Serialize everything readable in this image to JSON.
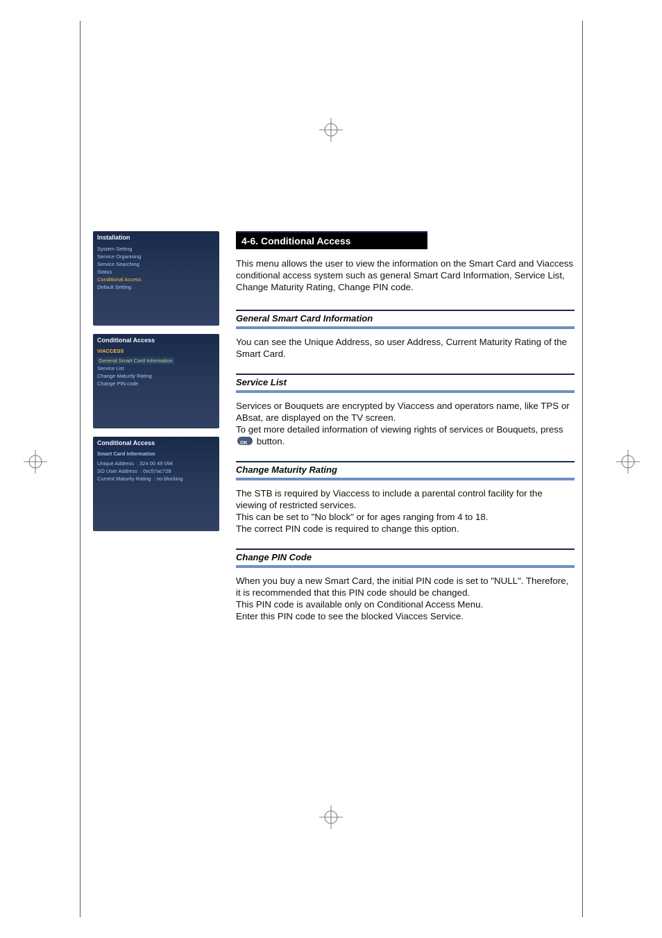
{
  "scr1": {
    "title": "Installation",
    "items": [
      "System Setting",
      "Service Organising",
      "Service Searching",
      "Status",
      "Conditional Access",
      "Default Setting"
    ]
  },
  "scr2": {
    "title": "Conditional Access",
    "sub": "VIACCESS",
    "hl": "General Smart Card Information",
    "items": [
      "Service List",
      "Change Maturity Rating",
      "Change PIN code"
    ]
  },
  "scr3": {
    "title": "Conditional Access",
    "sub": "Smart Card Information",
    "rows": [
      {
        "k": "Unique Address",
        "v": ": 324 00 49 094"
      },
      {
        "k": "SO User Address",
        "v": ": 0xc57ac728"
      },
      {
        "k": "Current Maturity Rating",
        "v": ": no blocking"
      }
    ]
  },
  "mainHeading": "4-6. Conditional Access",
  "intro": "This menu allows the user to view the information on the Smart Card and Viaccess conditional access system such as general Smart Card Information, Service List, Change Maturity Rating, Change PIN code.",
  "s1": {
    "h": "General Smart Card Information",
    "b": "You can see the Unique Address, so user Address, Current Maturity Rating of the Smart Card."
  },
  "s2": {
    "h": "Service List",
    "b1": "Services or Bouquets are encrypted by Viaccess and operators name, like TPS or ABsat, are displayed on the TV screen.",
    "b2a": "To get more detailed information of viewing rights of services or Bouquets, press ",
    "b2b": " button."
  },
  "s3": {
    "h": "Change Maturity Rating",
    "b1": "The STB is required by Viaccess to include a parental control facility for the viewing of restricted services.",
    "b2": "This can be set to \"No block\" or for ages ranging from 4 to 18.",
    "b3": "The correct PIN code is required to change this option."
  },
  "s4": {
    "h": "Change PIN Code",
    "b1": "When you buy a new Smart Card, the initial PIN code is set to \"NULL\". Therefore, it is recommended that this PIN code should be changed.",
    "b2": "This PIN code is available only on Conditional Access Menu.",
    "b3": "Enter this PIN code to see the blocked Viacces Service."
  }
}
